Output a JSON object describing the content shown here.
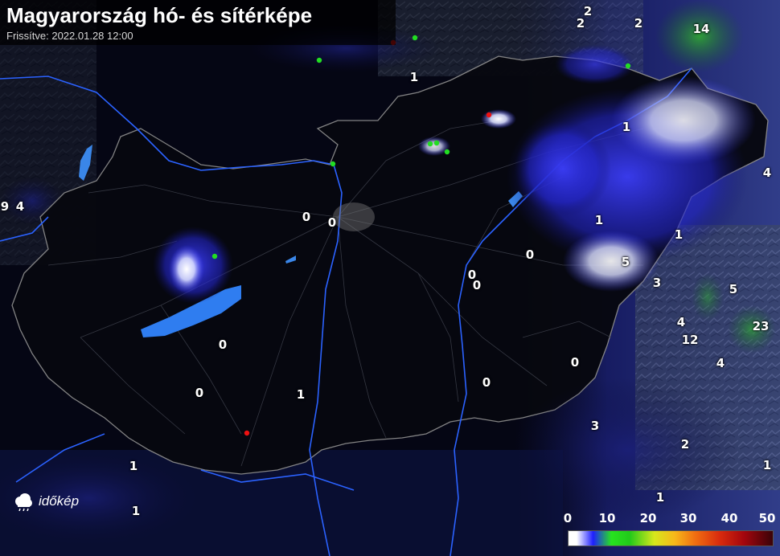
{
  "header": {
    "title": "Magyarország hó- és sítérképe",
    "subtitle": "Frissítve: 2022.01.28 12:00"
  },
  "logo": {
    "text": "időkép",
    "icon": "idokep-logo-icon"
  },
  "legend": {
    "ticks": [
      "0",
      "10",
      "20",
      "30",
      "40",
      "50"
    ],
    "colors": [
      "#ffffff",
      "#1f1fff",
      "#27e31f",
      "#d7e71c",
      "#f06e11",
      "#a3060d",
      "#3a0308"
    ]
  },
  "snow_depths": [
    {
      "label": "2",
      "id": "n1"
    },
    {
      "label": "2",
      "id": "n2"
    },
    {
      "label": "2",
      "id": "n3"
    },
    {
      "label": "14",
      "id": "n4"
    },
    {
      "label": "1",
      "id": "n5"
    },
    {
      "label": "1",
      "id": "n6"
    },
    {
      "label": "4",
      "id": "n7"
    },
    {
      "label": "9",
      "id": "n8"
    },
    {
      "label": "4",
      "id": "n9"
    },
    {
      "label": "0",
      "id": "n10"
    },
    {
      "label": "0",
      "id": "n11"
    },
    {
      "label": "1",
      "id": "n12"
    },
    {
      "label": "1",
      "id": "n13"
    },
    {
      "label": "0",
      "id": "n14"
    },
    {
      "label": "5",
      "id": "n15"
    },
    {
      "label": "0",
      "id": "n16"
    },
    {
      "label": "0",
      "id": "n17"
    },
    {
      "label": "3",
      "id": "n18"
    },
    {
      "label": "5",
      "id": "n19"
    },
    {
      "label": "4",
      "id": "n20"
    },
    {
      "label": "23",
      "id": "n21"
    },
    {
      "label": "12",
      "id": "n22"
    },
    {
      "label": "0",
      "id": "n23"
    },
    {
      "label": "4",
      "id": "n24"
    },
    {
      "label": "0",
      "id": "n25"
    },
    {
      "label": "0",
      "id": "n26"
    },
    {
      "label": "0",
      "id": "n27"
    },
    {
      "label": "1",
      "id": "n28"
    },
    {
      "label": "3",
      "id": "n29"
    },
    {
      "label": "2",
      "id": "n30"
    },
    {
      "label": "1",
      "id": "n31"
    },
    {
      "label": "1",
      "id": "n32"
    },
    {
      "label": "1",
      "id": "n33"
    },
    {
      "label": "1",
      "id": "n34"
    }
  ],
  "markers": [
    {
      "color": "#22dd22"
    },
    {
      "color": "#22dd22"
    },
    {
      "color": "#22dd22"
    },
    {
      "color": "#22dd22"
    },
    {
      "color": "#22dd22"
    },
    {
      "color": "#22dd22"
    },
    {
      "color": "#22dd22"
    },
    {
      "color": "#22dd22"
    },
    {
      "color": "#ee1111"
    },
    {
      "color": "#ee1111"
    },
    {
      "color": "#ee1111"
    }
  ]
}
